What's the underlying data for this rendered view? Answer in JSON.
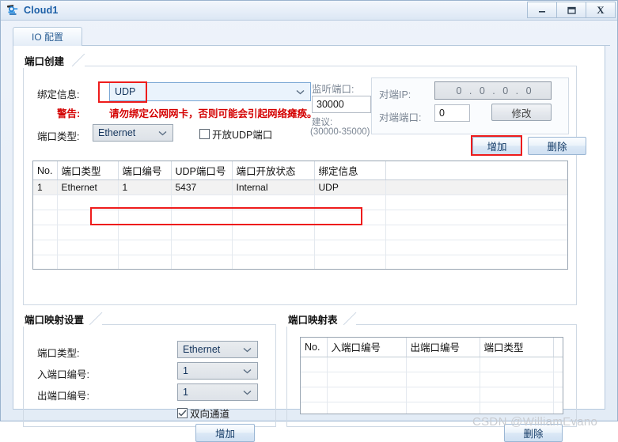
{
  "window": {
    "title": "Cloud1",
    "icon": "cloud-icon",
    "buttons": {
      "minimize": "minimize-icon",
      "maximize": "maximize-icon",
      "close": "X"
    }
  },
  "tabs": [
    {
      "label": "IO 配置",
      "active": true
    }
  ],
  "port_create": {
    "title": "端口创建",
    "binding_label": "绑定信息:",
    "binding_value": "UDP",
    "warning_label": "警告:",
    "warning_text": "请勿绑定公网网卡，否则可能会引起网络瘫痪。",
    "port_type_label": "端口类型:",
    "port_type_value": "Ethernet",
    "open_udp_label": "开放UDP端口",
    "open_udp_checked": false,
    "listen_port_label": "监听端口:",
    "listen_port_value": "30000",
    "suggestion_label": "建议:",
    "suggestion_range": "(30000-35000)",
    "peer_ip_label": "对端IP:",
    "peer_ip_value": "0 . 0 . 0 . 0",
    "peer_port_label": "对端端口:",
    "peer_port_value": "0",
    "modify_button": "修改",
    "add_button": "增加",
    "delete_button": "删除"
  },
  "port_table": {
    "headers": [
      "No.",
      "端口类型",
      "端口编号",
      "UDP端口号",
      "端口开放状态",
      "绑定信息",
      ""
    ],
    "rows": [
      [
        "1",
        "Ethernet",
        "1",
        "5437",
        "Internal",
        "UDP",
        ""
      ]
    ],
    "empty_row_count": 6
  },
  "port_mapping_settings": {
    "title": "端口映射设置",
    "port_type_label": "端口类型:",
    "port_type_value": "Ethernet",
    "in_port_label": "入端口编号:",
    "in_port_value": "1",
    "out_port_label": "出端口编号:",
    "out_port_value": "1",
    "bidirectional_label": "双向通道",
    "bidirectional_checked": true,
    "add_button": "增加"
  },
  "port_mapping_table": {
    "title": "端口映射表",
    "headers": [
      "No.",
      "入端口编号",
      "出端口编号",
      "端口类型",
      ""
    ],
    "empty_row_count": 5,
    "delete_button": "删除"
  },
  "watermark": "CSDN @WilliamEvano",
  "colors": {
    "accent": "#1b5ea6",
    "warning": "#d40000",
    "highlight": "#ee1c1c",
    "window_bg": "#e6eef8"
  }
}
